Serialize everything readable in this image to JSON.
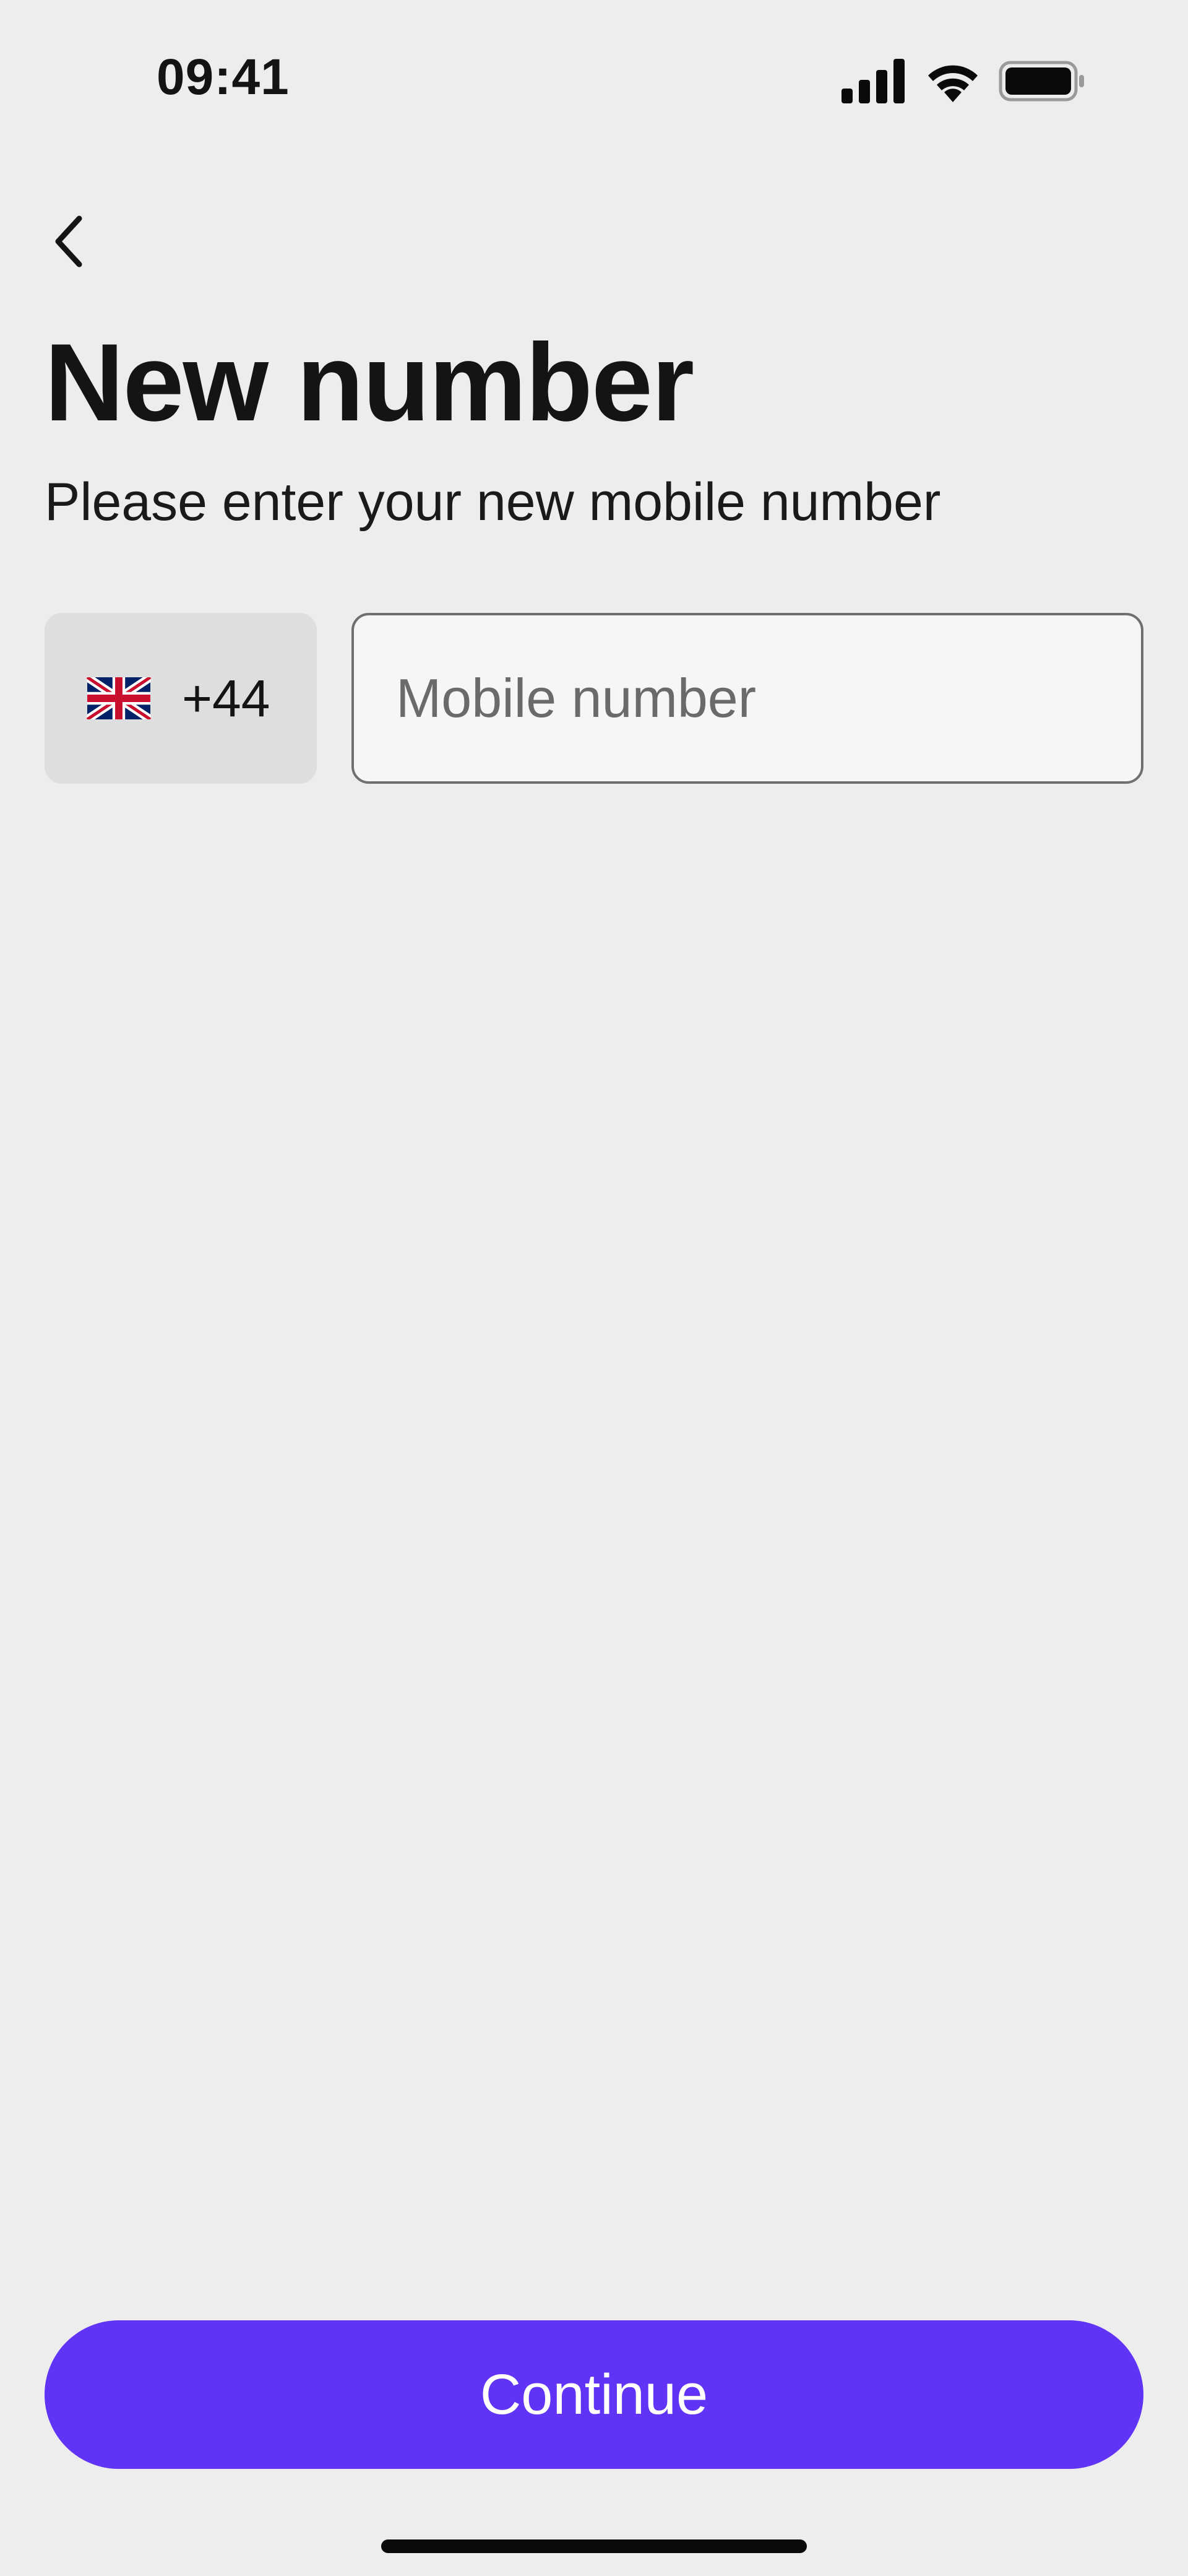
{
  "status_bar": {
    "time": "09:41",
    "signal_icon": "cellular-signal-icon",
    "wifi_icon": "wifi-icon",
    "battery_icon": "battery-full-icon"
  },
  "header": {
    "back_icon": "chevron-left-icon",
    "title": "New number",
    "subtitle": "Please enter your new mobile number"
  },
  "phone_form": {
    "country": {
      "flag_icon": "uk-flag-icon",
      "dial_code": "+44"
    },
    "mobile_input": {
      "value": "",
      "placeholder": "Mobile number"
    }
  },
  "footer": {
    "continue_label": "Continue"
  },
  "colors": {
    "background": "#ededed",
    "accent": "#6133f7",
    "text": "#141414",
    "country_picker_bg": "#dedede",
    "input_border": "#6f6f6f"
  }
}
